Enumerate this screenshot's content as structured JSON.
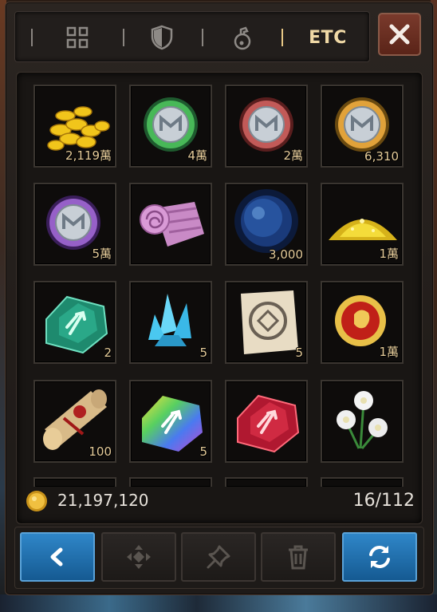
{
  "header": {
    "tabs": [
      {
        "icon": "grid-icon"
      },
      {
        "icon": "shield-icon"
      },
      {
        "icon": "potion-icon"
      },
      {
        "label": "ETC",
        "active": true
      }
    ],
    "close_icon": "close-icon"
  },
  "inventory": {
    "items": [
      {
        "name": "gold-coins-pile",
        "qty": "2,119萬"
      },
      {
        "name": "green-medal-coin",
        "qty": "4萬"
      },
      {
        "name": "red-medal-coin",
        "qty": "2萬"
      },
      {
        "name": "gold-medal-coin",
        "qty": "6,310"
      },
      {
        "name": "purple-medal-coin",
        "qty": "5萬"
      },
      {
        "name": "pink-cloth-roll",
        "qty": ""
      },
      {
        "name": "blue-energy-orb",
        "qty": "3,000"
      },
      {
        "name": "gold-dust-pile",
        "qty": "1萬"
      },
      {
        "name": "green-rune-stone",
        "qty": "2"
      },
      {
        "name": "blue-crystal",
        "qty": "5"
      },
      {
        "name": "rune-scroll-paper",
        "qty": "5"
      },
      {
        "name": "lion-emblem-coin",
        "qty": "1萬"
      },
      {
        "name": "sealed-scroll",
        "qty": "100"
      },
      {
        "name": "rainbow-rune-stone",
        "qty": "5"
      },
      {
        "name": "red-rune-stone",
        "qty": ""
      },
      {
        "name": "white-flowers",
        "qty": ""
      }
    ]
  },
  "footer": {
    "gold": "21,197,120",
    "capacity": "16/112"
  },
  "toolbar": {
    "buttons": [
      {
        "icon": "back-arrow-icon",
        "style": "blue"
      },
      {
        "icon": "move-icon",
        "style": "dark"
      },
      {
        "icon": "pin-icon",
        "style": "dark"
      },
      {
        "icon": "trash-icon",
        "style": "dark"
      },
      {
        "icon": "refresh-icon",
        "style": "blue"
      }
    ]
  },
  "colors": {
    "accent_gold": "#f0d9a6",
    "button_blue": "#2f86c8",
    "close_red": "#7a3a2c"
  }
}
